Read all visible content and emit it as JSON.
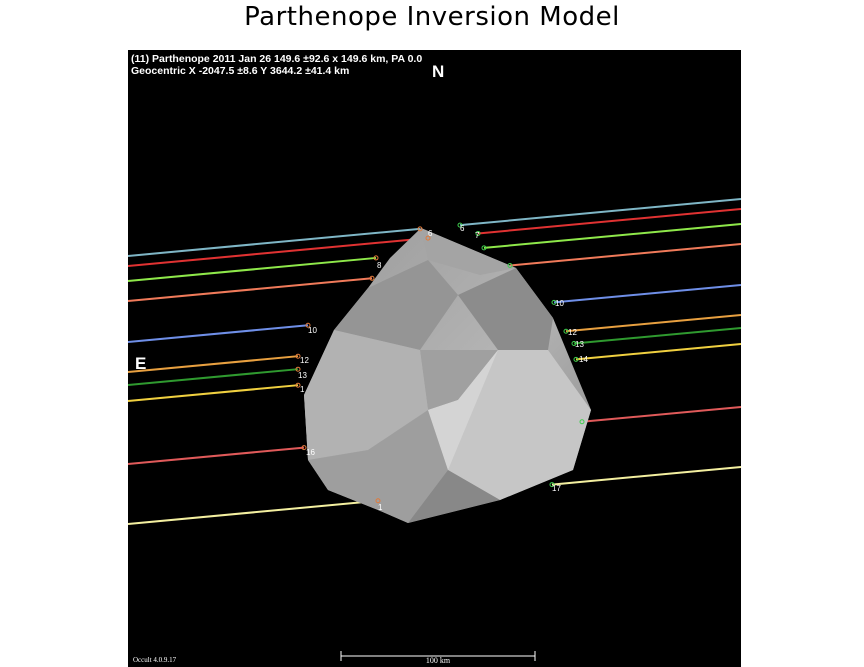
{
  "page": {
    "title": "Parthenope Inversion Model"
  },
  "plot": {
    "header_line1": "(11) Parthenope 2011 Jan 26  149.6 ±92.6 x 149.6 km, PA 0.0",
    "header_line2": "Geocentric X  -2047.5 ±8.6  Y 3644.2 ±41.4 km",
    "north_label": "N",
    "east_label": "E",
    "version": "Occult 4.0.9.17",
    "scale_label": "100 km",
    "colors": {
      "background": "#000000",
      "asteroid": "#a9a9a9",
      "text": "#ffffff"
    }
  },
  "chords": [
    {
      "color": "#7fb6c6"
    },
    {
      "color": "#e03232"
    },
    {
      "color": "#8ee84a"
    },
    {
      "color": "#f07a5a"
    },
    {
      "color": "#6f8fe8"
    },
    {
      "color": "#e8a040"
    },
    {
      "color": "#2f9a2f"
    },
    {
      "color": "#f0d040"
    },
    {
      "color": "#e05a5a"
    },
    {
      "color": "#f4f0a0"
    }
  ],
  "chord_labels": {
    "left": [
      "6",
      "8",
      "10",
      "12",
      "13",
      "1",
      "16",
      "1"
    ],
    "right": [
      "6",
      "7",
      "10",
      "12",
      "13",
      "14",
      "17"
    ]
  }
}
